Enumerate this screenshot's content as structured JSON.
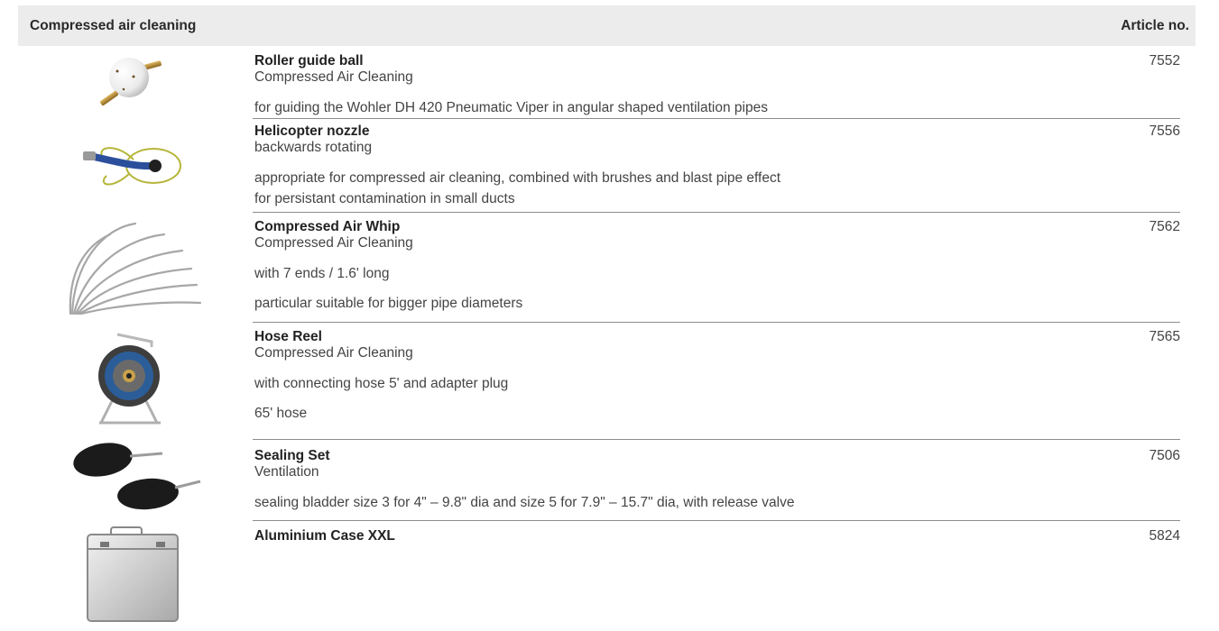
{
  "header": {
    "category": "Compressed air cleaning",
    "article_col": "Article no."
  },
  "items": [
    {
      "title": "Roller guide ball",
      "subtitle": "Compressed Air Cleaning",
      "desc": [
        "for guiding the Wohler DH 420 Pneumatic Viper in angular shaped ventilation pipes"
      ],
      "article": "7552",
      "image": "roller-guide-ball-image"
    },
    {
      "title": "Helicopter nozzle",
      "subtitle": "backwards rotating",
      "desc": [
        "appropriate for compressed air cleaning, combined with brushes and blast pipe effect",
        "for persistant contamination in small ducts"
      ],
      "article": "7556",
      "image": "helicopter-nozzle-image"
    },
    {
      "title": "Compressed Air Whip",
      "subtitle": "Compressed Air Cleaning",
      "desc": [
        "with 7 ends / 1.6' long",
        "particular suitable for bigger pipe diameters"
      ],
      "article": "7562",
      "image": "air-whip-image"
    },
    {
      "title": "Hose Reel",
      "subtitle": "Compressed Air Cleaning",
      "desc": [
        "with connecting hose 5' and adapter plug",
        "65' hose"
      ],
      "article": "7565",
      "image": "hose-reel-image"
    },
    {
      "title": "Sealing Set",
      "subtitle": "Ventilation",
      "desc": [
        "sealing bladder size 3 for 4\" – 9.8\" dia and size 5 for 7.9\" – 15.7\" dia, with release valve"
      ],
      "article": "7506",
      "image": "sealing-set-image"
    },
    {
      "title": "Aluminium Case XXL",
      "subtitle": "",
      "desc": [],
      "article": "5824",
      "image": "aluminium-case-image"
    }
  ]
}
